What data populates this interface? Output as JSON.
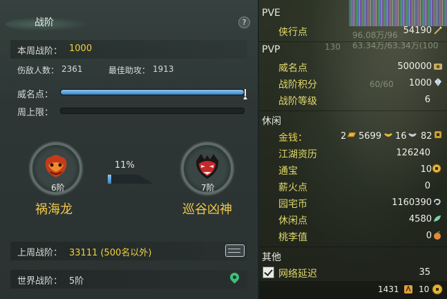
{
  "left": {
    "title": "战阶",
    "help": "?",
    "weekly_rank_label": "本周战阶：",
    "weekly_rank_value": "1000",
    "kills_label": "伤敌人数：",
    "kills_value": "2361",
    "assists_label": "最佳助攻：",
    "assists_value": "1913",
    "prestige_label": "威名点：",
    "prestige_progress": 1.0,
    "cap_label": "周上限：",
    "cap_progress": 0.0,
    "current_rank": {
      "tier": "6阶",
      "name": "祸海龙"
    },
    "next_rank": {
      "tier": "7阶",
      "name": "巡谷凶神"
    },
    "advance_percent": "11%",
    "advance_progress": 0.11,
    "last_week_label": "上周战阶：",
    "last_week_value": "33111 (500名以外)",
    "world_rank_label": "世界战阶：",
    "world_rank_value": "5阶"
  },
  "right": {
    "hud": {
      "line1": "96.08万/96",
      "line2": "63.34万/63.34万(100",
      "line3": "130",
      "line4": "60/60"
    },
    "sections": {
      "pve": "PVE",
      "pvp": "PVP",
      "leisure": "休闲",
      "other": "其他"
    },
    "pve_rows": [
      {
        "label": "侠行点",
        "value": "54190",
        "icon": "sword-icon"
      }
    ],
    "pvp_rows": [
      {
        "label": "威名点",
        "value": "500000",
        "icon": "token-icon"
      },
      {
        "label": "战阶积分",
        "value": "1000",
        "icon": "crystal-icon"
      },
      {
        "label": "战阶等级",
        "value": "6"
      }
    ],
    "money": {
      "label": "金钱：",
      "gold_bars": "2",
      "gold_ingot": "5699",
      "silver": "16",
      "copper": "82"
    },
    "leisure_rows": [
      {
        "label": "江湖资历",
        "value": "126240"
      },
      {
        "label": "通宝",
        "value": "10",
        "icon": "coin-icon"
      },
      {
        "label": "薪火点",
        "value": "0"
      },
      {
        "label": "园宅币",
        "value": "1160390",
        "icon": "swirl-icon"
      },
      {
        "label": "休闲点",
        "value": "4580",
        "icon": "leaf-icon"
      },
      {
        "label": "桃李值",
        "value": "0",
        "icon": "peach-icon"
      }
    ],
    "other_rows": [
      {
        "label": "网络延迟",
        "value": "35",
        "checked": true
      }
    ],
    "footer": {
      "count": "1431",
      "coins": "10"
    }
  },
  "colors": {
    "accent_yellow": "#f2d23a",
    "bar_blue": "#3b86c7",
    "rank_name_gold": "#f0c84a"
  }
}
